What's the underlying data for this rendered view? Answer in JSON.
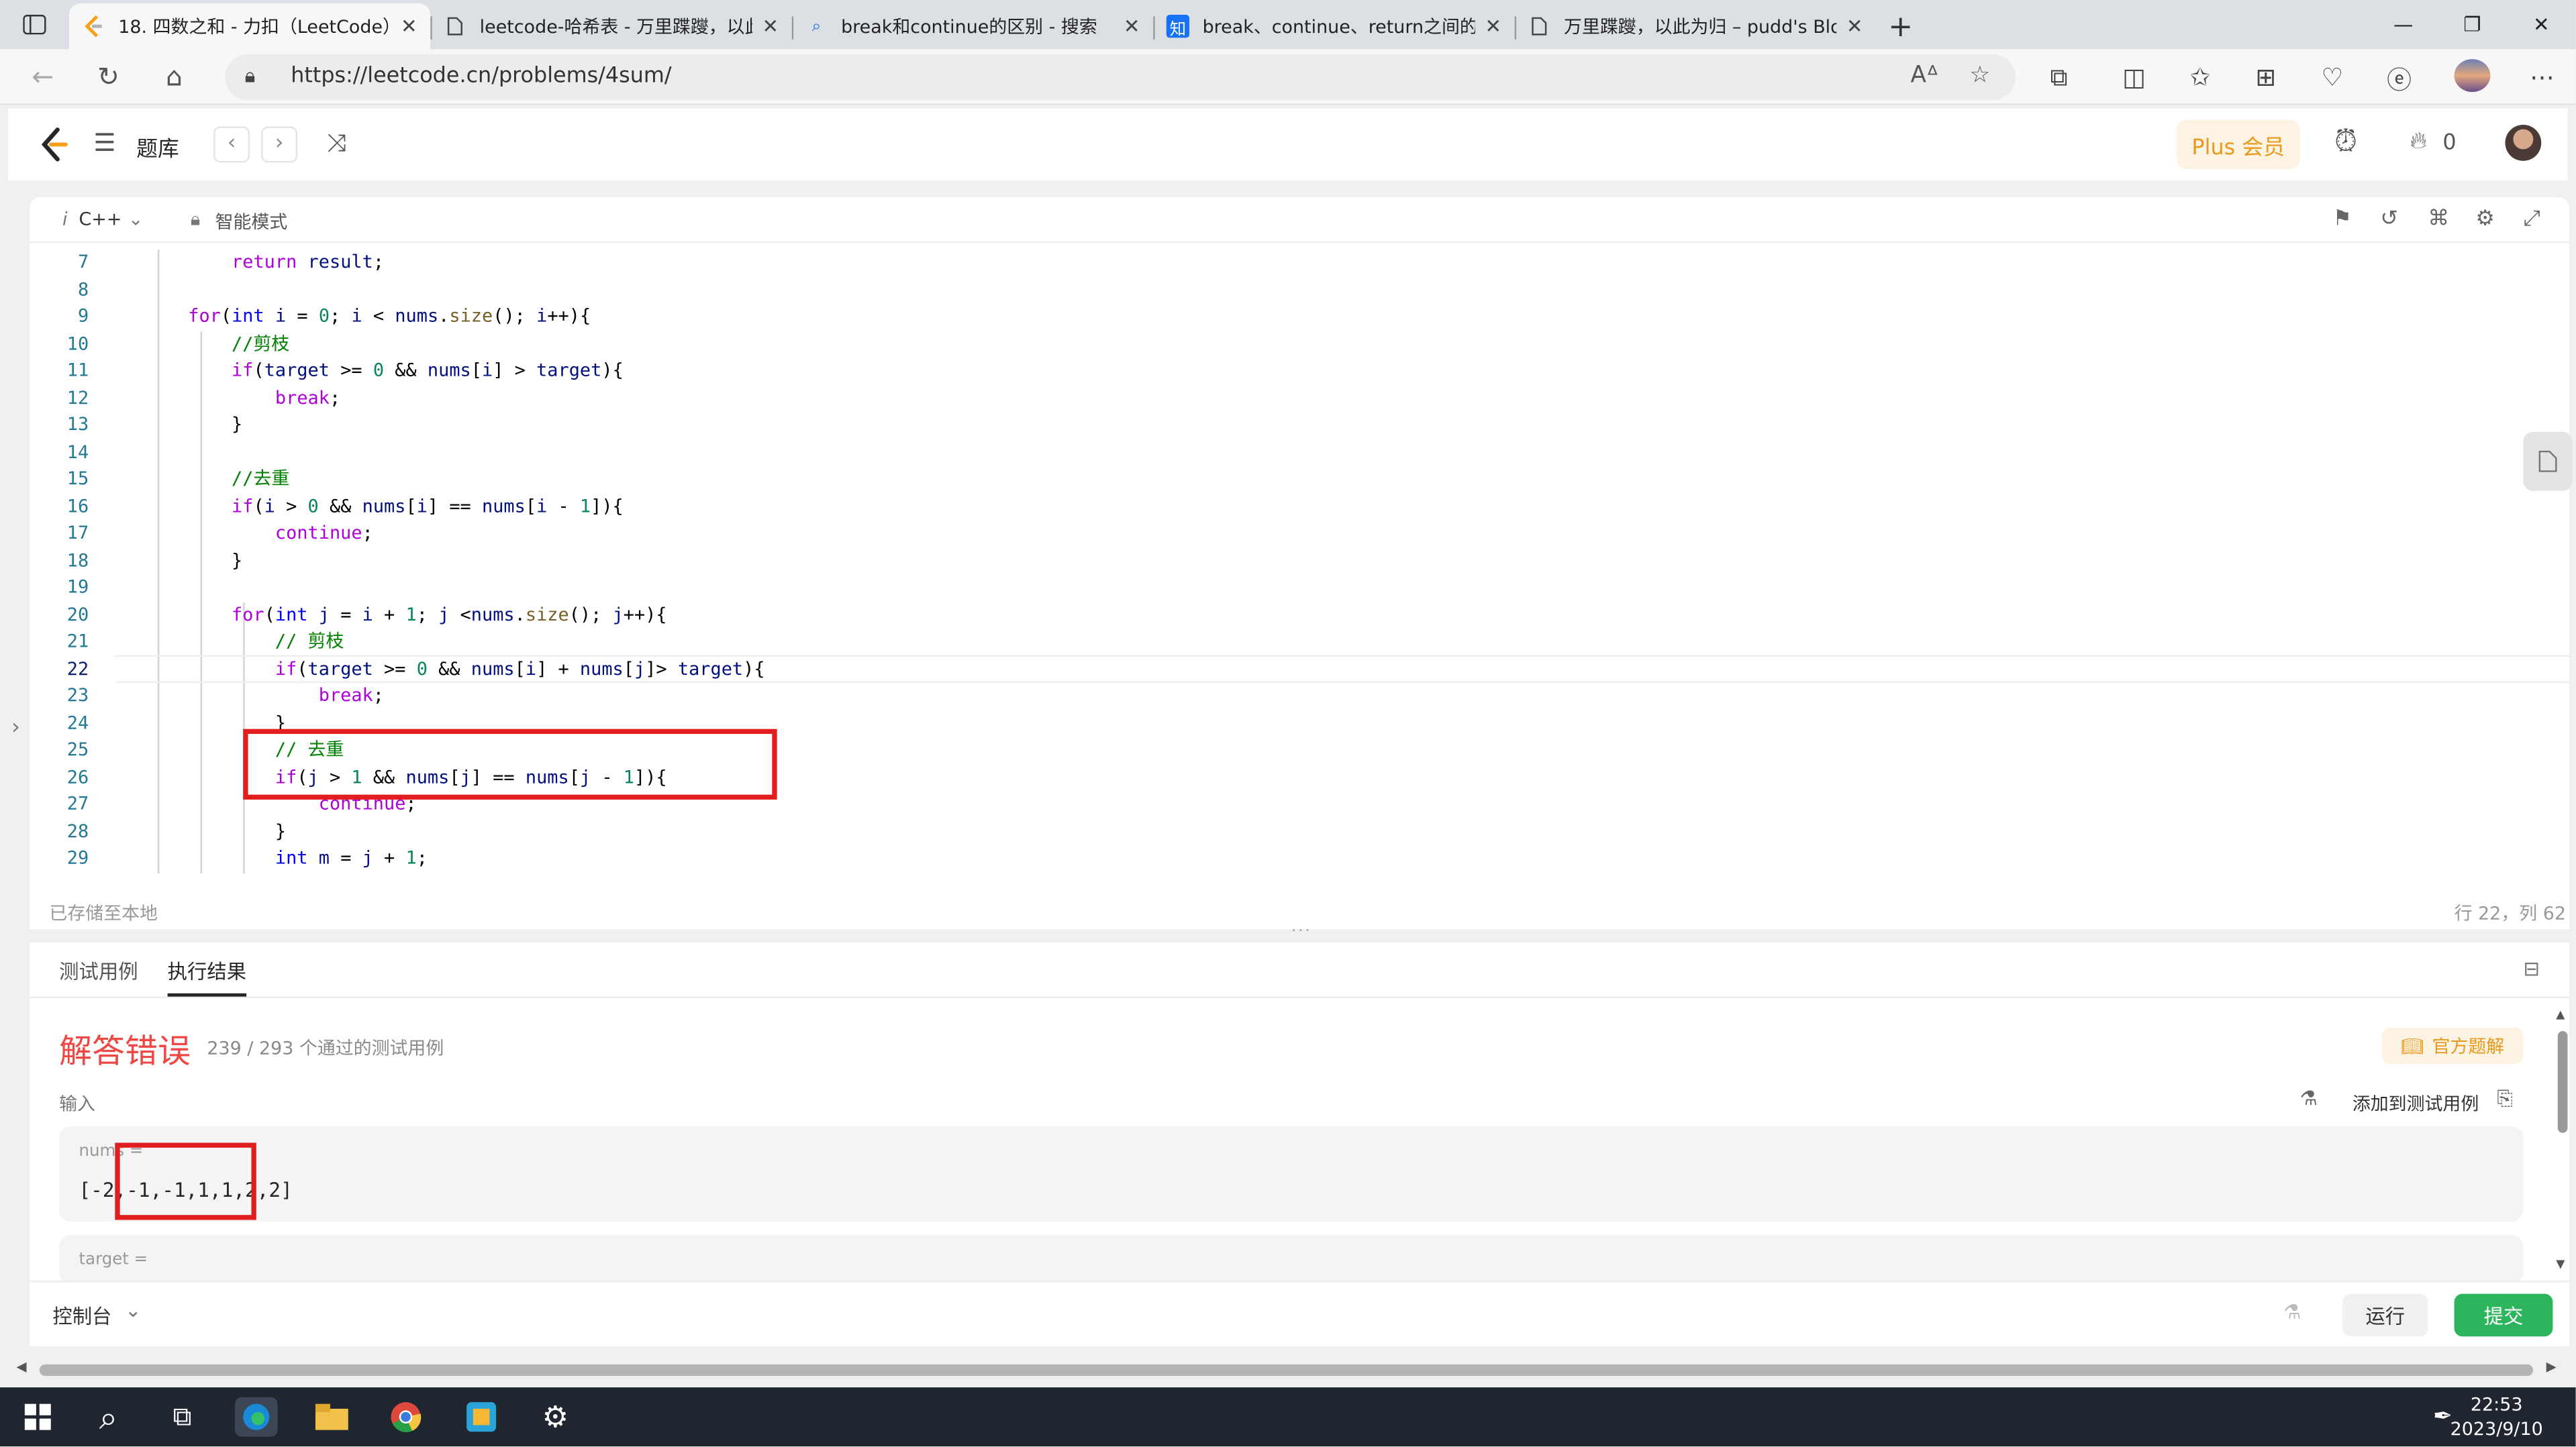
{
  "browser": {
    "tabs": [
      {
        "title": "18. 四数之和 - 力扣（LeetCode）",
        "icon": "leetcode-icon",
        "active": true
      },
      {
        "title": "leetcode-哈希表 - 万里蹀躞，以此为归",
        "icon": "document-icon",
        "active": false
      },
      {
        "title": "break和continue的区别 - 搜索",
        "icon": "search-icon",
        "active": false
      },
      {
        "title": "break、continue、return之间的区别",
        "icon": "zhihu-icon",
        "active": false
      },
      {
        "title": "万里蹀躞，以此为归 – pudd's Blog",
        "icon": "document-icon",
        "active": false
      }
    ],
    "url": "https://leetcode.cn/problems/4sum/"
  },
  "header": {
    "problem_bank": "题库",
    "plus_label": "Plus 会员",
    "streak_count": "0"
  },
  "editor": {
    "language": "C++",
    "mode": "智能模式",
    "saved_status": "已存储至本地",
    "cursor_position": "行 22，列 62",
    "lines": [
      {
        "no": "7",
        "code": "        return result;"
      },
      {
        "no": "8",
        "code": ""
      },
      {
        "no": "9",
        "code": "    for(int i = 0; i < nums.size(); i++){"
      },
      {
        "no": "10",
        "code": "        //剪枝"
      },
      {
        "no": "11",
        "code": "        if(target >= 0 && nums[i] > target){"
      },
      {
        "no": "12",
        "code": "            break;"
      },
      {
        "no": "13",
        "code": "        }"
      },
      {
        "no": "14",
        "code": ""
      },
      {
        "no": "15",
        "code": "        //去重"
      },
      {
        "no": "16",
        "code": "        if(i > 0 && nums[i] == nums[i - 1]){"
      },
      {
        "no": "17",
        "code": "            continue;"
      },
      {
        "no": "18",
        "code": "        }"
      },
      {
        "no": "19",
        "code": ""
      },
      {
        "no": "20",
        "code": "        for(int j = i + 1; j <nums.size(); j++){"
      },
      {
        "no": "21",
        "code": "            // 剪枝"
      },
      {
        "no": "22",
        "code": "            if(target >= 0 && nums[i] + nums[j]> target){"
      },
      {
        "no": "23",
        "code": "                break;"
      },
      {
        "no": "24",
        "code": "            }"
      },
      {
        "no": "25",
        "code": "            // 去重"
      },
      {
        "no": "26",
        "code": "            if(j > 1 && nums[j] == nums[j - 1]){"
      },
      {
        "no": "27",
        "code": "                continue;"
      },
      {
        "no": "28",
        "code": "            }"
      },
      {
        "no": "29",
        "code": "            int m = j + 1;"
      }
    ]
  },
  "results": {
    "tab_testcase": "测试用例",
    "tab_result": "执行结果",
    "verdict": "解答错误",
    "passed": "239 / 293  个通过的测试用例",
    "official_solution": "官方题解",
    "input_label": "输入",
    "add_testcase": "添加到测试用例",
    "nums_label": "nums =",
    "nums_value": "[-2,-1,-1,1,1,2,2]",
    "target_label": "target ="
  },
  "console": {
    "label": "控制台",
    "run": "运行",
    "submit": "提交"
  },
  "taskbar": {
    "time": "22:53",
    "date": "2023/9/10"
  },
  "colors": {
    "wrong_answer": "#ef4743",
    "submit_green": "#2db55d",
    "plus_orange": "#e99a1d",
    "highlight_box": "#e11d1d"
  }
}
